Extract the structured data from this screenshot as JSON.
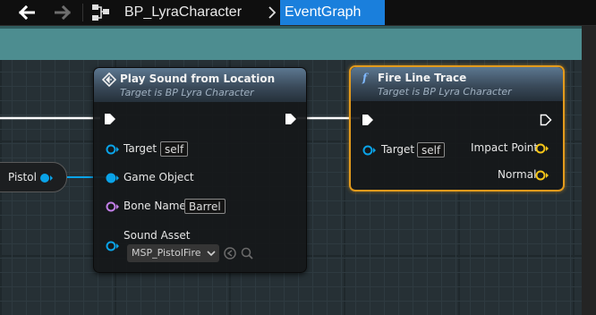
{
  "toolbar": {
    "back_icon": "arrow-left-icon",
    "forward_icon": "arrow-right-icon"
  },
  "breadcrumb": {
    "blueprint_icon": "blueprint-graph-icon",
    "blueprint": "BP_LyraCharacter",
    "graph": "EventGraph"
  },
  "colors": {
    "accent": "#1a7fdc",
    "exec_wire": "#ffffff",
    "object_pin": "#0aa3e8",
    "name_pin": "#c27fe8",
    "vector_pin": "#f5c518",
    "selected_border": "#e39a1c",
    "header_strip": "#4d8d90"
  },
  "nodes": {
    "pistol": {
      "label": "Pistol"
    },
    "play_sound": {
      "icon": "sound-node-icon",
      "title": "Play Sound from Location",
      "subtitle": "Target is BP Lyra Character",
      "target_label": "Target",
      "target_value": "self",
      "game_object_label": "Game Object",
      "bone_name_label": "Bone Name",
      "bone_name_value": "Barrel",
      "sound_asset_label": "Sound Asset",
      "sound_asset_value": "MSP_PistolFire"
    },
    "fire_line_trace": {
      "icon": "function-icon",
      "title": "Fire Line Trace",
      "subtitle": "Target is BP Lyra Character",
      "target_label": "Target",
      "target_value": "self",
      "impact_point_label": "Impact Point",
      "normal_label": "Normal"
    }
  }
}
